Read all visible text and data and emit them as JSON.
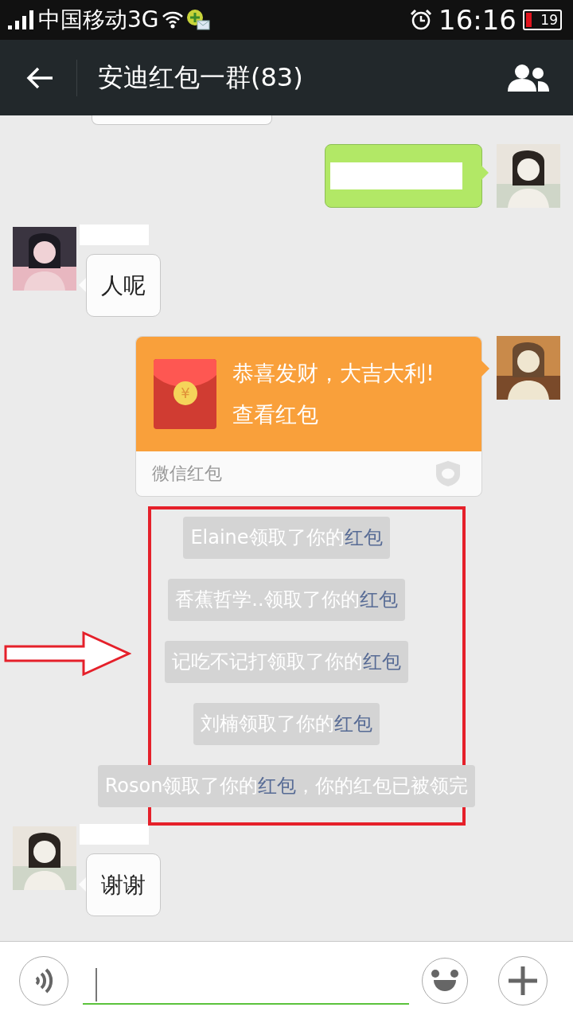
{
  "status_bar": {
    "carrier": "中国移动3G",
    "time": "16:16",
    "battery": "19"
  },
  "header": {
    "title": "安迪红包一群(83)"
  },
  "messages": [
    {
      "kind": "stub",
      "outgoing": false
    },
    {
      "kind": "redacted",
      "outgoing": true
    },
    {
      "kind": "text",
      "outgoing": false,
      "text": "人呢"
    },
    {
      "kind": "red_packet",
      "outgoing": true,
      "coin": "¥",
      "greeting": "恭喜发财，大吉大利!",
      "action": "查看红包",
      "footer": "微信红包"
    },
    {
      "kind": "notice",
      "parts": [
        {
          "text": "Elaine领取了你的",
          "link": false
        },
        {
          "text": "红包",
          "link": true
        }
      ]
    },
    {
      "kind": "notice",
      "parts": [
        {
          "text": "香蕉哲学..领取了你的",
          "link": false
        },
        {
          "text": "红包",
          "link": true
        }
      ]
    },
    {
      "kind": "notice",
      "parts": [
        {
          "text": "记吃不记打领取了你的",
          "link": false
        },
        {
          "text": "红包",
          "link": true
        }
      ]
    },
    {
      "kind": "notice",
      "parts": [
        {
          "text": "刘楠领取了你的",
          "link": false
        },
        {
          "text": "红包",
          "link": true
        }
      ]
    },
    {
      "kind": "notice",
      "parts": [
        {
          "text": "Roson领取了你的",
          "link": false
        },
        {
          "text": "红包",
          "link": true
        },
        {
          "text": "，你的红包已被领完",
          "link": false
        }
      ]
    },
    {
      "kind": "text",
      "outgoing": false,
      "text": "谢谢"
    }
  ]
}
